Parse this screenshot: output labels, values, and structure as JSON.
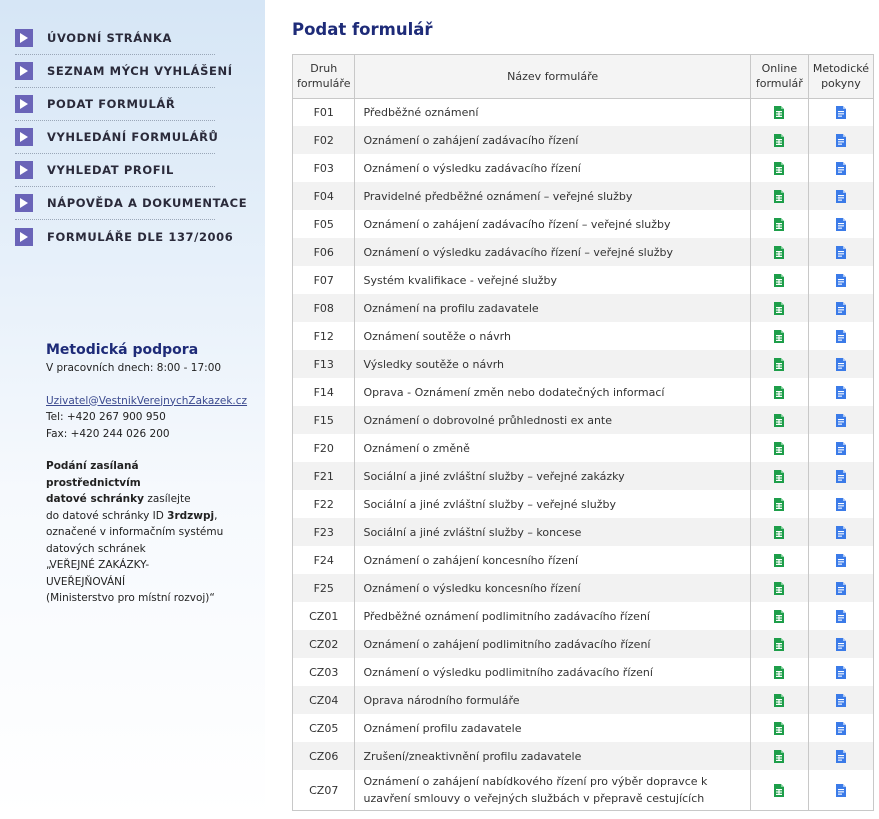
{
  "nav": {
    "items": [
      {
        "label": "ÚVODNÍ STRÁNKA"
      },
      {
        "label": "SEZNAM MÝCH VYHLÁŠENÍ"
      },
      {
        "label": "PODAT FORMULÁŘ"
      },
      {
        "label": "VYHLEDÁNÍ FORMULÁŘŮ"
      },
      {
        "label": "VYHLEDAT PROFIL"
      },
      {
        "label": "NÁPOVĚDA A DOKUMENTACE"
      },
      {
        "label": "FORMULÁŘE DLE 137/2006"
      }
    ]
  },
  "support": {
    "title": "Metodická podpora",
    "hours": "V pracovních dnech: 8:00 - 17:00",
    "email": "Uzivatel@VestnikVerejnychZakazek.cz",
    "tel": "Tel: +420 267 900 950",
    "fax": "Fax: +420 244 026 200",
    "line1": "Podání zasílaná",
    "line2": "prostřednictvím",
    "line3_bold": "datové schránky",
    "line3_rest": " zasílejte",
    "line4_pre": "do datové schránky ID ",
    "line4_id": "3rdzwpj",
    "line4_post": ",",
    "line5": "označené v informačním systému",
    "line6": "datových schránek",
    "line7": "„VEŘEJNÉ ZAKÁZKY-",
    "line8": "UVEŘEJŇOVÁNÍ",
    "line9": "(Ministerstvo pro místní rozvoj)“"
  },
  "main": {
    "title": "Podat formulář",
    "headers": {
      "code_l1": "Druh",
      "code_l2": "formuláře",
      "name": "Název formuláře",
      "online_l1": "Online",
      "online_l2": "formulář",
      "doc_l1": "Metodické",
      "doc_l2": "pokyny"
    },
    "rows": [
      {
        "code": "F01",
        "name": "Předběžné oznámení"
      },
      {
        "code": "F02",
        "name": "Oznámení o zahájení zadávacího řízení"
      },
      {
        "code": "F03",
        "name": "Oznámení o výsledku zadávacího řízení"
      },
      {
        "code": "F04",
        "name": "Pravidelné předběžné oznámení – veřejné služby"
      },
      {
        "code": "F05",
        "name": "Oznámení o zahájení zadávacího řízení – veřejné služby"
      },
      {
        "code": "F06",
        "name": "Oznámení o výsledku zadávacího řízení – veřejné služby"
      },
      {
        "code": "F07",
        "name": "Systém kvalifikace - veřejné služby"
      },
      {
        "code": "F08",
        "name": "Oznámení na profilu zadavatele"
      },
      {
        "code": "F12",
        "name": "Oznámení soutěže o návrh"
      },
      {
        "code": "F13",
        "name": "Výsledky soutěže o návrh"
      },
      {
        "code": "F14",
        "name": "Oprava - Oznámení změn nebo dodatečných informací"
      },
      {
        "code": "F15",
        "name": "Oznámení o dobrovolné průhlednosti ex ante"
      },
      {
        "code": "F20",
        "name": "Oznámení o změně"
      },
      {
        "code": "F21",
        "name": "Sociální a jiné zvláštní služby – veřejné zakázky"
      },
      {
        "code": "F22",
        "name": "Sociální a jiné zvláštní služby – veřejné služby"
      },
      {
        "code": "F23",
        "name": "Sociální a jiné zvláštní služby – koncese"
      },
      {
        "code": "F24",
        "name": "Oznámení o zahájení koncesního řízení"
      },
      {
        "code": "F25",
        "name": "Oznámení o výsledku koncesního řízení"
      },
      {
        "code": "CZ01",
        "name": "Předběžné oznámení podlimitního zadávacího řízení"
      },
      {
        "code": "CZ02",
        "name": "Oznámení o zahájení podlimitního zadávacího řízení"
      },
      {
        "code": "CZ03",
        "name": "Oznámení o výsledku podlimitního zadávacího řízení"
      },
      {
        "code": "CZ04",
        "name": "Oprava národního formuláře"
      },
      {
        "code": "CZ05",
        "name": "Oznámení profilu zadavatele"
      },
      {
        "code": "CZ06",
        "name": "Zrušení/zneaktivnění profilu zadavatele"
      },
      {
        "code": "CZ07",
        "name": "Oznámení o zahájení nabídkového řízení pro výběr dopravce k uzavření smlouvy o veřejných službách v přepravě cestujících"
      }
    ]
  },
  "colors": {
    "accent": "#1e2b78",
    "nav_bullet": "#6a64b8",
    "online_icon": "#1e9e4a",
    "doc_icon": "#3b7be8"
  },
  "icons": {
    "nav_bullet": "play-triangle-icon",
    "online": "green-sheet-icon",
    "doc": "blue-document-icon"
  }
}
